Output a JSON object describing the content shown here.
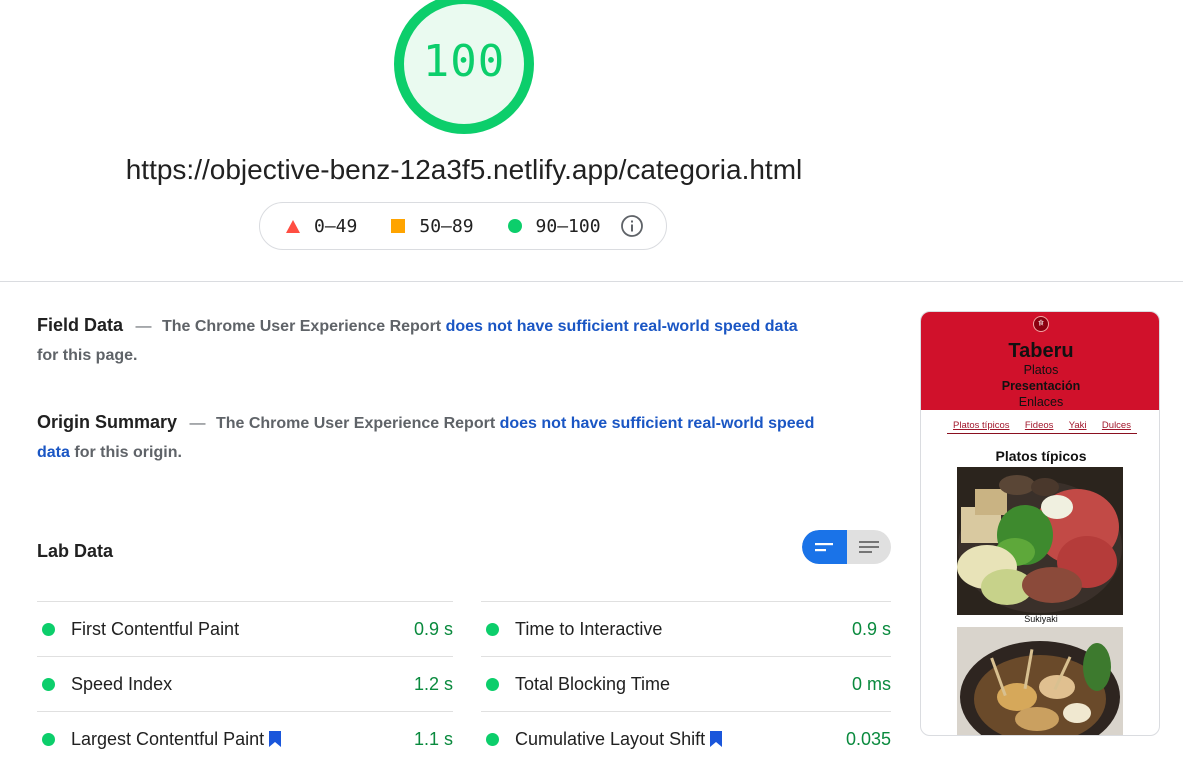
{
  "score": {
    "value": "100",
    "color": "#0cce6b"
  },
  "url": "https://objective-benz-12a3f5.netlify.app/categoria.html",
  "legend": {
    "fail": "0–49",
    "average": "50–89",
    "pass": "90–100"
  },
  "field_data": {
    "heading": "Field Data",
    "dash": "—",
    "prefix": "The Chrome User Experience Report",
    "link": "does not have sufficient real-world speed data",
    "suffix": "for this page."
  },
  "origin_summary": {
    "heading": "Origin Summary",
    "dash": "—",
    "prefix": "The Chrome User Experience Report",
    "link": "does not have sufficient real-world speed data",
    "suffix": "for this origin."
  },
  "lab_data": {
    "heading": "Lab Data",
    "metrics_left": [
      {
        "name": "First Contentful Paint",
        "value": "0.9 s",
        "bookmark": false
      },
      {
        "name": "Speed Index",
        "value": "1.2 s",
        "bookmark": false
      },
      {
        "name": "Largest Contentful Paint",
        "value": "1.1 s",
        "bookmark": true
      }
    ],
    "metrics_right": [
      {
        "name": "Time to Interactive",
        "value": "0.9 s",
        "bookmark": false
      },
      {
        "name": "Total Blocking Time",
        "value": "0 ms",
        "bookmark": false
      },
      {
        "name": "Cumulative Layout Shift",
        "value": "0.035",
        "bookmark": true
      }
    ]
  },
  "thumbnail": {
    "logo": "食",
    "brand": "Taberu",
    "nav": [
      "Platos",
      "Presentación",
      "Enlaces"
    ],
    "subnav": [
      "Platos típicos",
      "Fideos",
      "Yaki",
      "Dulces"
    ],
    "section_title": "Platos típicos",
    "caption": "Sukiyaki",
    "banner_color": "#d0112b"
  }
}
